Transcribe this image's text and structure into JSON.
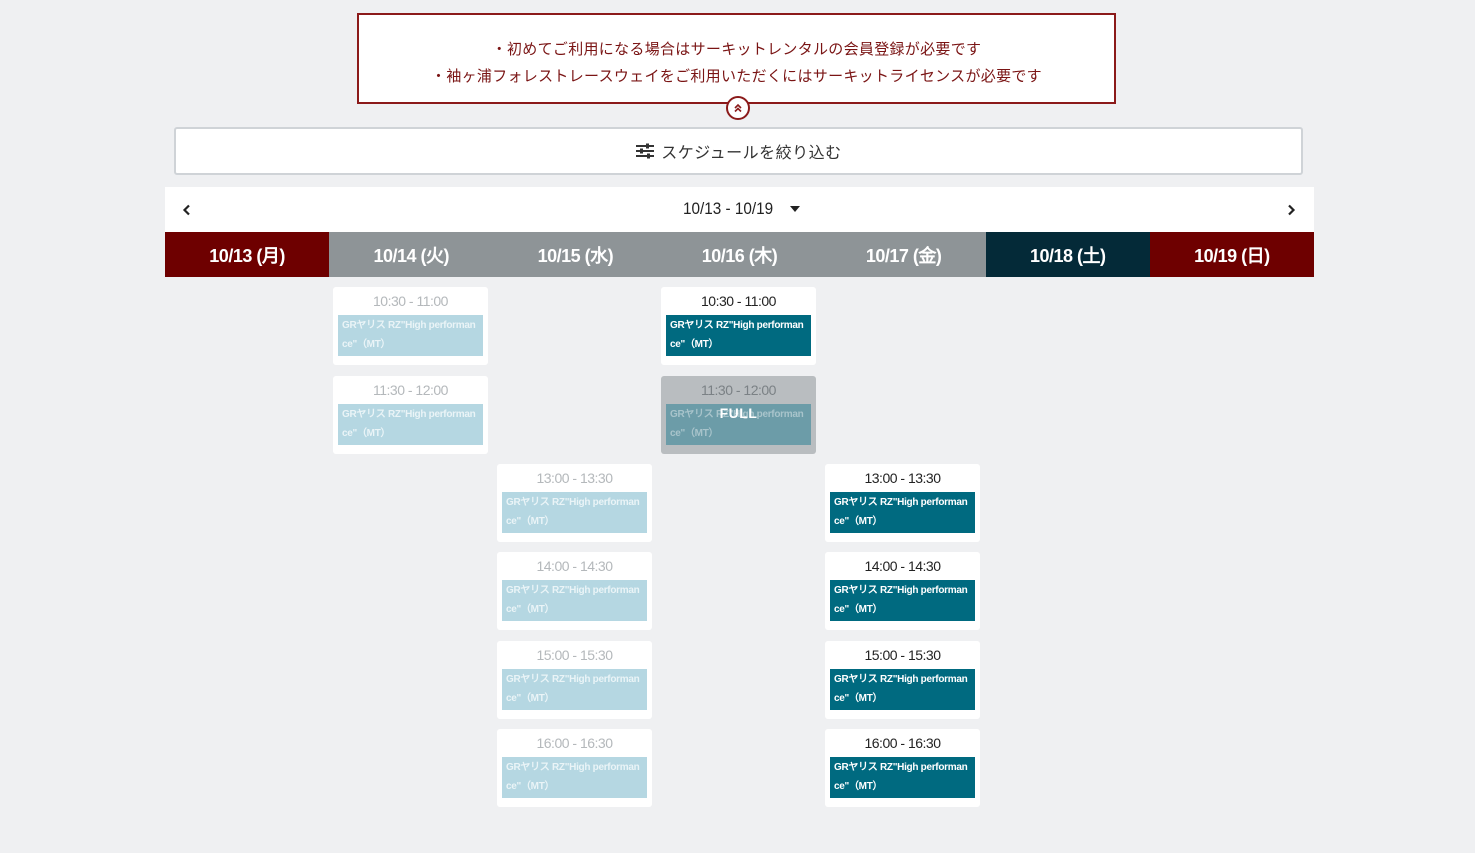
{
  "notice": {
    "lines": [
      "・初めてご利用になる場合はサーキットレンタルの会員登録が必要です",
      "・袖ヶ浦フォレストレースウェイをご利用いただくにはサーキットライセンスが必要です"
    ],
    "collapse_icon": "chevron-double-up-icon"
  },
  "filter": {
    "label": "スケジュールを絞り込む",
    "icon": "sliders-icon"
  },
  "week": {
    "label": "10/13 - 10/19",
    "prev_icon": "chevron-left-icon",
    "next_icon": "chevron-right-icon",
    "dropdown_icon": "caret-down-icon"
  },
  "days": [
    {
      "label": "10/13 (月)",
      "color": "#6e0000"
    },
    {
      "label": "10/14 (火)",
      "color": "#8e9497"
    },
    {
      "label": "10/15 (水)",
      "color": "#8e9497"
    },
    {
      "label": "10/16 (木)",
      "color": "#8e9497"
    },
    {
      "label": "10/17 (金)",
      "color": "#8e9497"
    },
    {
      "label": "10/18 (土)",
      "color": "#042a38"
    },
    {
      "label": "10/19 (日)",
      "color": "#6e0000"
    }
  ],
  "colors": {
    "accent_red": "#8b1a1a",
    "plan_available": "#006a80",
    "plan_disabled": "#b5d7e2",
    "page_bg": "#eff0f2"
  },
  "slots": [
    {
      "day": "10/14 (火)",
      "time": "10:30 - 11:00",
      "plan": "GRヤリス RZ\"High performance\"（MT）",
      "status": "disabled"
    },
    {
      "day": "10/14 (火)",
      "time": "11:30 - 12:00",
      "plan": "GRヤリス RZ\"High performance\"（MT）",
      "status": "disabled"
    },
    {
      "day": "10/16 (木)",
      "time": "10:30 - 11:00",
      "plan": "GRヤリス RZ\"High performance\"（MT）",
      "status": "available"
    },
    {
      "day": "10/16 (木)",
      "time": "11:30 - 12:00",
      "plan": "GRヤリス RZ\"High performance\"（MT）",
      "status": "full",
      "badge": "FULL"
    },
    {
      "day": "10/15 (水)",
      "time": "13:00 - 13:30",
      "plan": "GRヤリス RZ\"High performance\"（MT）",
      "status": "disabled"
    },
    {
      "day": "10/15 (水)",
      "time": "14:00 - 14:30",
      "plan": "GRヤリス RZ\"High performance\"（MT）",
      "status": "disabled"
    },
    {
      "day": "10/15 (水)",
      "time": "15:00 - 15:30",
      "plan": "GRヤリス RZ\"High performance\"（MT）",
      "status": "disabled"
    },
    {
      "day": "10/15 (水)",
      "time": "16:00 - 16:30",
      "plan": "GRヤリス RZ\"High performance\"（MT）",
      "status": "disabled"
    },
    {
      "day": "10/17 (金)",
      "time": "13:00 - 13:30",
      "plan": "GRヤリス RZ\"High performance\"（MT）",
      "status": "available"
    },
    {
      "day": "10/17 (金)",
      "time": "14:00 - 14:30",
      "plan": "GRヤリス RZ\"High performance\"（MT）",
      "status": "available"
    },
    {
      "day": "10/17 (金)",
      "time": "15:00 - 15:30",
      "plan": "GRヤリス RZ\"High performance\"（MT）",
      "status": "available"
    },
    {
      "day": "10/17 (金)",
      "time": "16:00 - 16:30",
      "plan": "GRヤリス RZ\"High performance\"（MT）",
      "status": "available"
    }
  ]
}
